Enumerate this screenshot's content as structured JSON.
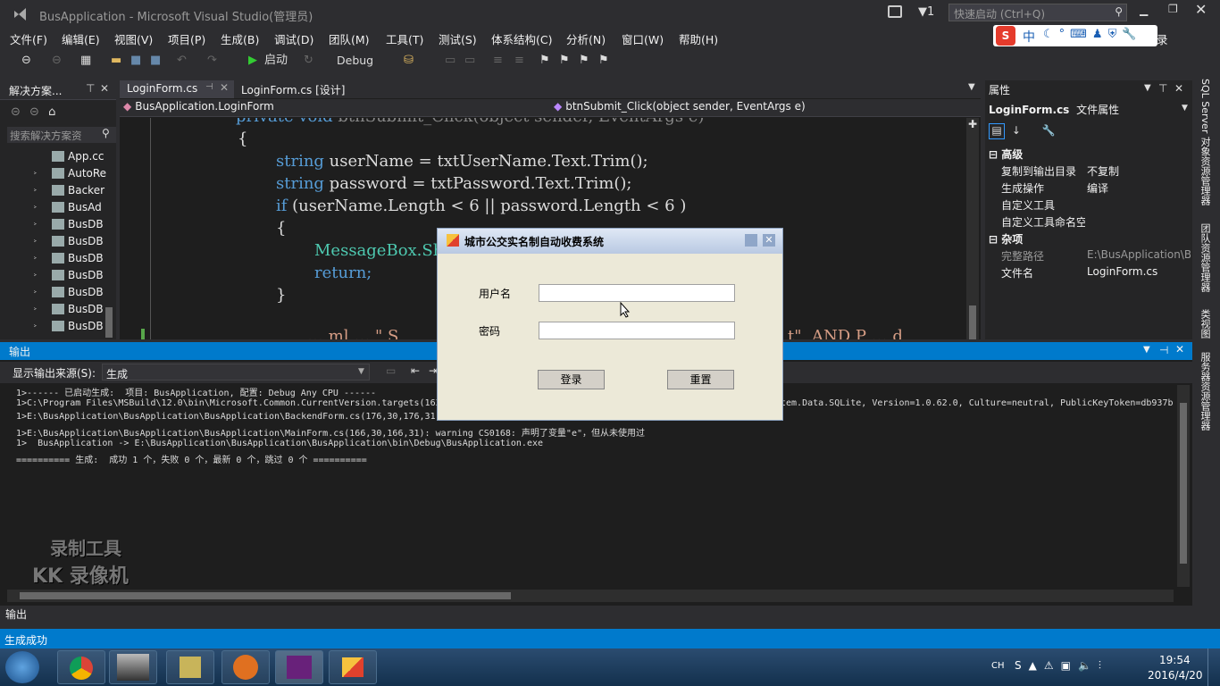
{
  "window": {
    "title": "BusApplication - Microsoft Visual Studio(管理员)",
    "notify_count": "1",
    "quick_launch": "快速启动 (Ctrl+Q)"
  },
  "menu": [
    "文件(F)",
    "编辑(E)",
    "视图(V)",
    "项目(P)",
    "生成(B)",
    "调试(D)",
    "团队(M)",
    "工具(T)",
    "测试(S)",
    "体系结构(C)",
    "分析(N)",
    "窗口(W)",
    "帮助(H)"
  ],
  "menu_extra": "录",
  "ime": {
    "logo": "S",
    "mode": "中"
  },
  "toolbar": {
    "start_label": "启动",
    "config": "Debug"
  },
  "solution_explorer": {
    "title": "解决方案...",
    "search_placeholder": "搜索解决方案资",
    "items": [
      "App.cc",
      "AutoRe",
      "Backer",
      "BusAd",
      "BusDB",
      "BusDB",
      "BusDB",
      "BusDB",
      "BusDB",
      "BusDB",
      "BusDB"
    ]
  },
  "editor": {
    "tabs": [
      "LoginForm.cs",
      "LoginForm.cs [设计]"
    ],
    "class_nav": "BusApplication.LoginForm",
    "member_nav": "btnSubmit_Click(object sender, EventArgs e)",
    "lines": {
      "l0a": "private void ",
      "l0b": "btnSubmit_Click(object sender, EventArgs e)",
      "l1": "{",
      "l2a": "string",
      "l2b": " userName = txtUserName.Text.Trim();",
      "l3a": "string",
      "l3b": " password = txtPassword.Text.Trim();",
      "l4a": "if",
      "l4b": " (userName.Length < 6 || password.Length < 6 )",
      "l5": "{",
      "l6": "MessageBox.Sh",
      "l7": "return;",
      "l8": "}",
      "l9a": "… ml … \" S",
      "l9b": "t\", AND P … d"
    }
  },
  "properties": {
    "title": "属性",
    "object": "LoginForm.cs",
    "object_type": "文件属性",
    "sections": [
      {
        "name": "高级",
        "rows": [
          {
            "k": "复制到输出目录",
            "v": "不复制"
          },
          {
            "k": "生成操作",
            "v": "编译"
          },
          {
            "k": "自定义工具",
            "v": ""
          },
          {
            "k": "自定义工具命名空",
            "v": ""
          }
        ]
      },
      {
        "name": "杂项",
        "rows": [
          {
            "k": "完整路径",
            "v": "E:\\BusApplication\\B"
          },
          {
            "k": "文件名",
            "v": "LoginForm.cs"
          }
        ]
      }
    ]
  },
  "vertical_tabs": [
    "SQL Server 对象资源管理器",
    "团队资源管理器",
    "类视图",
    "服务器资源管理器"
  ],
  "output": {
    "title": "输出",
    "source_label": "显示输出来源(S):",
    "source_value": "生成",
    "lines": [
      "1>------ 已启动生成:  项目: BusApplication, 配置: Debug Any CPU ------",
      "1>C:\\Program Files\\MSBuild\\12.0\\bin\\Microsoft.Common.CurrentVersion.targets(163",
      "1>E:\\BusApplication\\BusApplication\\BusApplication\\BackendForm.cs(176,30,176,31)",
      "1>E:\\BusApplication\\BusApplication\\BusApplication\\MainForm.cs(166,30,166,31): warning CS0168: 声明了变量\"e\"，但从未使用过",
      "1>  BusApplication -> E:\\BusApplication\\BusApplication\\BusApplication\\bin\\Debug\\BusApplication.exe",
      "========== 生成:  成功 1 个，失败 0 个，最新 0 个，跳过 0 个 =========="
    ],
    "line2_tail": "tem.Data.SQLite, Version=1.0.62.0, Culture=neutral, PublicKeyToken=db937b",
    "bottom_tab": "输出"
  },
  "watermark": {
    "line1": "录制工具",
    "line2": "KK 录像机"
  },
  "status": "生成成功",
  "dialog": {
    "title": "城市公交实名制自动收费系统",
    "username_label": "用户名",
    "password_label": "密码",
    "login_button": "登录",
    "reset_button": "重置"
  },
  "taskbar": {
    "lang": "CH",
    "time": "19:54",
    "date": "2016/4/20"
  },
  "colors": {
    "accent": "#007acc",
    "bg": "#2d2d30",
    "editor_bg": "#1e1e1e",
    "keyword": "#569cd6"
  }
}
